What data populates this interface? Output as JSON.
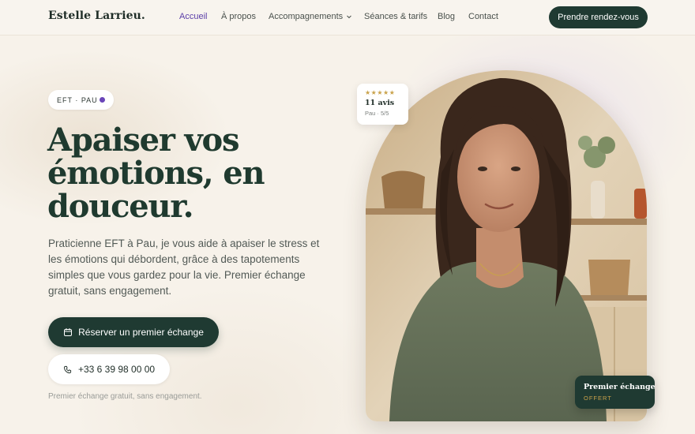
{
  "header": {
    "logo": "Estelle Larrieu.",
    "nav": [
      {
        "label": "Accueil"
      },
      {
        "label": "À propos"
      },
      {
        "label": "Accompagnements"
      },
      {
        "label": "Séances & tarifs"
      },
      {
        "label": "Blog"
      },
      {
        "label": "Contact"
      }
    ],
    "cta": "Prendre rendez-vous"
  },
  "hero": {
    "badge": "EFT · PAU",
    "title_lines": [
      "Apaiser vos",
      "émotions, en",
      "douceur."
    ],
    "lead": "Praticienne EFT à Pau, je vous aide à apaiser le stress et les émotions qui débordent, grâce à des tapotements simples que vous gardez pour la vie. Premier échange gratuit, sans engagement.",
    "primary_button": "Réserver un premier échange",
    "phone_button": "+33 6 39 98 00 00",
    "note": "Premier échange gratuit, sans engagement."
  },
  "review_card": {
    "stars": "★★★★★",
    "count": "11 avis",
    "meta": "Pau · 5/5"
  },
  "offer_card": {
    "title": "Premier échange",
    "subtitle": "OFFERT"
  },
  "colors": {
    "accent": "#1f3a32",
    "nav_active": "#5b3ea8",
    "badge_dot": "#6a45b8",
    "gold": "#c9a24a",
    "background": "#f7f2ea"
  }
}
